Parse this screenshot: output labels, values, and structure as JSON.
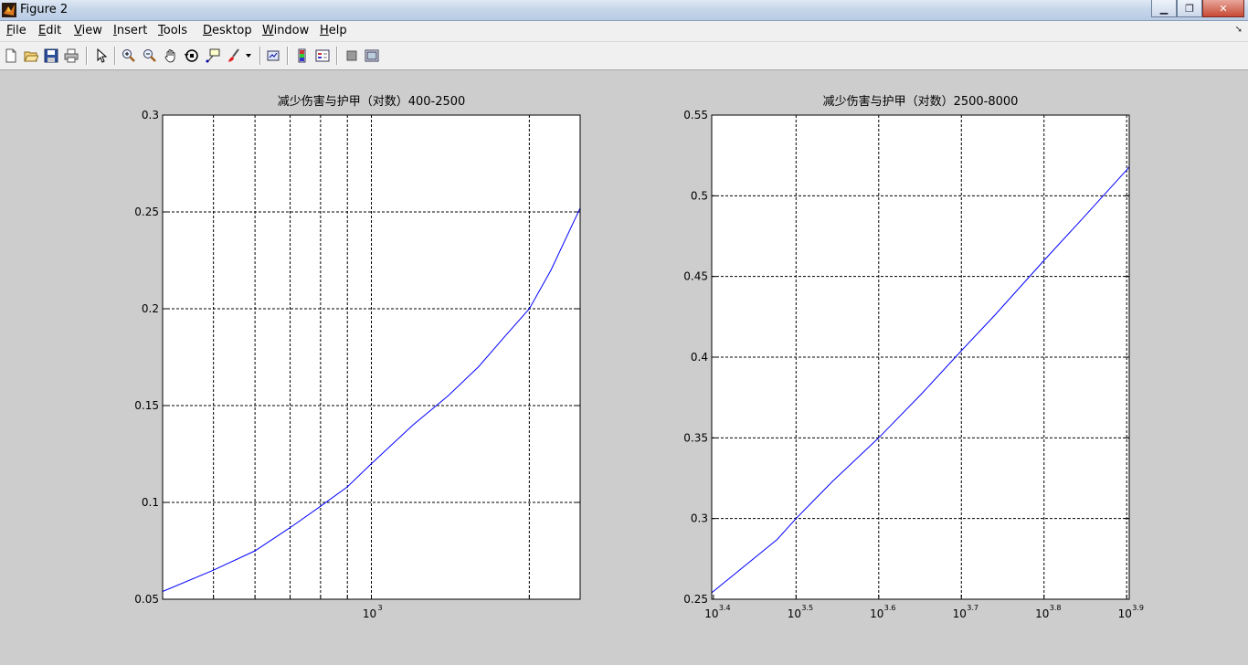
{
  "window": {
    "title": "Figure 2"
  },
  "menu": [
    {
      "label": "File",
      "u": "F",
      "rest": "ile"
    },
    {
      "label": "Edit",
      "u": "E",
      "rest": "dit"
    },
    {
      "label": "View",
      "u": "V",
      "rest": "iew"
    },
    {
      "label": "Insert",
      "u": "I",
      "rest": "nsert"
    },
    {
      "label": "Tools",
      "u": "T",
      "rest": "ools"
    },
    {
      "label": "Desktop",
      "u": "D",
      "rest": "esktop"
    },
    {
      "label": "Window",
      "u": "W",
      "rest": "indow"
    },
    {
      "label": "Help",
      "u": "H",
      "rest": "elp"
    }
  ],
  "toolbar": {
    "icons": [
      "new-figure-icon",
      "open-file-icon",
      "save-icon",
      "print-icon",
      "edit-plot-icon",
      "zoom-in-icon",
      "zoom-out-icon",
      "pan-icon",
      "rotate-3d-icon",
      "data-cursor-icon",
      "brush-icon",
      "link-plot-icon",
      "colorbar-icon",
      "legend-icon",
      "hide-plot-tools-icon",
      "show-plot-tools-icon"
    ]
  },
  "chart_data": [
    {
      "type": "line",
      "title": "减少伤害与护甲（对数）400-2500",
      "xscale": "log",
      "xlim": [
        400,
        2500
      ],
      "ylim": [
        0.05,
        0.3
      ],
      "yticks": [
        "0.05",
        "0.1",
        "0.15",
        "0.2",
        "0.25",
        "0.3"
      ],
      "ytick_values": [
        0.05,
        0.1,
        0.15,
        0.2,
        0.25,
        0.3
      ],
      "xtick_label": {
        "base": "10",
        "exp": "3",
        "value": 1000
      },
      "xgrid": [
        500,
        600,
        700,
        800,
        900,
        1000,
        2000
      ],
      "grid": true,
      "color": "#0000ff",
      "series": [
        {
          "x": [
            400,
            500,
            600,
            700,
            800,
            900,
            1000,
            1200,
            1400,
            1600,
            1800,
            2000,
            2200,
            2500
          ],
          "y": [
            0.054,
            0.065,
            0.075,
            0.087,
            0.098,
            0.108,
            0.12,
            0.14,
            0.155,
            0.17,
            0.186,
            0.2,
            0.22,
            0.252
          ]
        }
      ]
    },
    {
      "type": "line",
      "title": "减少伤害与护甲（对数）2500-8000",
      "xscale": "log",
      "xlim": [
        2500,
        8000
      ],
      "ylim": [
        0.25,
        0.55
      ],
      "yticks": [
        "0.25",
        "0.3",
        "0.35",
        "0.4",
        "0.45",
        "0.5",
        "0.55"
      ],
      "ytick_values": [
        0.25,
        0.3,
        0.35,
        0.4,
        0.45,
        0.5,
        0.55
      ],
      "xticks": [
        {
          "base": "10",
          "exp": "3.4",
          "value": 2511.9
        },
        {
          "base": "10",
          "exp": "3.5",
          "value": 3162.3
        },
        {
          "base": "10",
          "exp": "3.6",
          "value": 3981.1
        },
        {
          "base": "10",
          "exp": "3.7",
          "value": 5011.9
        },
        {
          "base": "10",
          "exp": "3.8",
          "value": 6309.6
        },
        {
          "base": "10",
          "exp": "3.9",
          "value": 7943.3
        }
      ],
      "grid": true,
      "color": "#0000ff",
      "series": [
        {
          "x": [
            2500,
            3000,
            3162,
            3500,
            3981,
            4500,
            5012,
            5500,
            6310,
            7000,
            7943,
            8000
          ],
          "y": [
            0.254,
            0.287,
            0.3,
            0.323,
            0.35,
            0.378,
            0.404,
            0.426,
            0.46,
            0.485,
            0.516,
            0.518
          ]
        }
      ]
    }
  ]
}
